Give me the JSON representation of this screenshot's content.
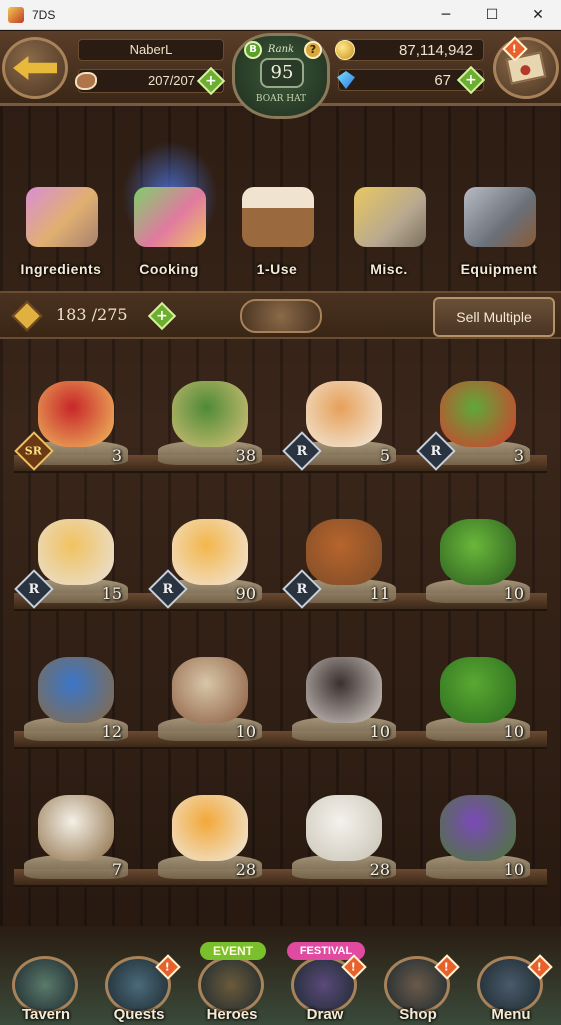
{
  "window": {
    "title": "7DS",
    "minimize_glyph": "─",
    "maximize_glyph": "☐",
    "close_glyph": "✕"
  },
  "header": {
    "player_name": "NaberL",
    "stamina": "207/207",
    "rank_label": "Rank",
    "rank": "95",
    "shop_name": "BOAR HAT",
    "rank_badge": "B",
    "help_glyph": "?",
    "gold": "87,114,942",
    "gems": "67",
    "plus_glyph": "+",
    "alert_glyph": "!"
  },
  "categories": [
    {
      "label": "Ingredients",
      "selected": false
    },
    {
      "label": "Cooking",
      "selected": true
    },
    {
      "label": "1-Use",
      "selected": false
    },
    {
      "label": "Misc.",
      "selected": false
    },
    {
      "label": "Equipment",
      "selected": false
    }
  ],
  "inventory": {
    "count": "183 /275",
    "sell_multiple": "Sell Multiple"
  },
  "items": [
    {
      "name": "birthday-cake",
      "qty": "3",
      "rarity": "SR",
      "colors": [
        "#c8262a",
        "#f0c060"
      ]
    },
    {
      "name": "wine-bottle",
      "qty": "38",
      "rarity": "",
      "colors": [
        "#4f8a36",
        "#d9c37a"
      ]
    },
    {
      "name": "shrimp-pizza",
      "qty": "5",
      "rarity": "R",
      "colors": [
        "#e6a05a",
        "#f4efe4"
      ]
    },
    {
      "name": "salad",
      "qty": "3",
      "rarity": "R",
      "colors": [
        "#5fa83a",
        "#d83a2e"
      ]
    },
    {
      "name": "cherry-pudding",
      "qty": "15",
      "rarity": "R",
      "colors": [
        "#f1c260",
        "#e8e2da"
      ]
    },
    {
      "name": "caramel-pudding",
      "qty": "90",
      "rarity": "R",
      "colors": [
        "#f3b64a",
        "#f1e8e0"
      ]
    },
    {
      "name": "meat-pie",
      "qty": "11",
      "rarity": "R",
      "colors": [
        "#b7652c",
        "#7a4a28"
      ]
    },
    {
      "name": "asparagus",
      "qty": "10",
      "rarity": "",
      "colors": [
        "#6ab83a",
        "#2a5a20"
      ]
    },
    {
      "name": "blue-eggs",
      "qty": "12",
      "rarity": "",
      "colors": [
        "#3a76c8",
        "#8a6a42"
      ]
    },
    {
      "name": "mushrooms",
      "qty": "10",
      "rarity": "",
      "colors": [
        "#d8c6a8",
        "#8a5a3e"
      ]
    },
    {
      "name": "truffles",
      "qty": "10",
      "rarity": "",
      "colors": [
        "#3a3030",
        "#d8d0c8"
      ]
    },
    {
      "name": "herbs",
      "qty": "10",
      "rarity": "",
      "colors": [
        "#5aa832",
        "#2a6a1e"
      ]
    },
    {
      "name": "white-eggs",
      "qty": "7",
      "rarity": "",
      "colors": [
        "#f4f0e6",
        "#8a6a42"
      ]
    },
    {
      "name": "honeycomb",
      "qty": "28",
      "rarity": "",
      "colors": [
        "#f2a838",
        "#f0ece4"
      ]
    },
    {
      "name": "tofu",
      "qty": "28",
      "rarity": "",
      "colors": [
        "#f4f2ec",
        "#c8c2b4"
      ]
    },
    {
      "name": "lavender",
      "qty": "10",
      "rarity": "",
      "colors": [
        "#7a4ab8",
        "#4a7a30"
      ]
    }
  ],
  "nav": [
    {
      "label": "Tavern",
      "badge": false,
      "tag": ""
    },
    {
      "label": "Quests",
      "badge": true,
      "tag": ""
    },
    {
      "label": "Heroes",
      "badge": false,
      "tag": "EVENT"
    },
    {
      "label": "Draw",
      "badge": true,
      "tag": "FESTIVAL"
    },
    {
      "label": "Shop",
      "badge": true,
      "tag": ""
    },
    {
      "label": "Menu",
      "badge": true,
      "tag": ""
    }
  ]
}
